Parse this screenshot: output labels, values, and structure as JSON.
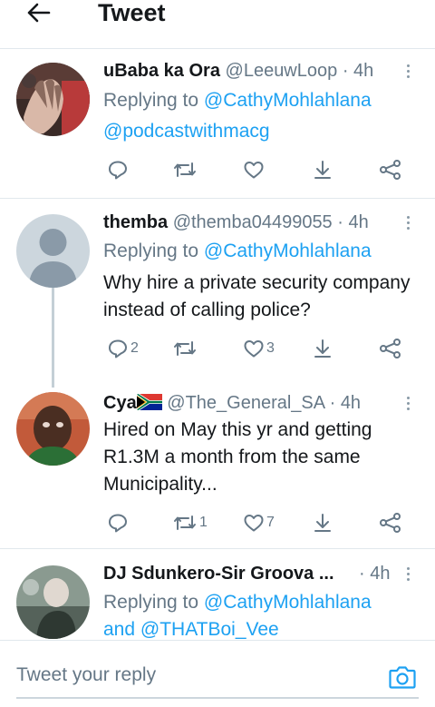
{
  "header": {
    "title": "Tweet"
  },
  "tweets": [
    {
      "name": "uBaba ka Ora",
      "handle": "@LeeuwLoop",
      "sep": "·",
      "time": "4h",
      "replying_label": "Replying to",
      "replying_to": [
        "@CathyMohlahlana",
        "@podcastwithmacg"
      ],
      "counts": {
        "reply": "",
        "retweet": "",
        "like": ""
      }
    },
    {
      "name": "themba",
      "handle": "@themba04499055",
      "sep": "·",
      "time": "4h",
      "replying_label": "Replying to",
      "replying_to": [
        "@CathyMohlahlana"
      ],
      "text_lines": [
        "Why hire a private security company",
        "instead of calling police?"
      ],
      "counts": {
        "reply": "2",
        "retweet": "",
        "like": "3"
      }
    },
    {
      "name": "Cya",
      "flag_icon": "south-africa-flag",
      "handle": "@The_General_SA",
      "sep": "·",
      "time": "4h",
      "text_lines": [
        "Hired on May this yr and getting",
        "R1.3M a month from the same",
        "Municipality..."
      ],
      "counts": {
        "reply": "",
        "retweet": "1",
        "like": "7"
      }
    },
    {
      "name": "DJ Sdunkero-Sir Groova ...",
      "sep": "·",
      "time": "4h",
      "replying_label": "Replying to",
      "replying_to": [
        "@CathyMohlahlana"
      ],
      "conjunction": "and",
      "replying_to_more": "@THATBoi_Vee"
    }
  ],
  "reply_bar": {
    "placeholder": "Tweet your reply"
  },
  "colors": {
    "link": "#1da1f2",
    "secondary_text": "#657786",
    "primary_text": "#14171a",
    "divider": "#e1e8ed"
  },
  "icons": [
    "back-arrow",
    "more-vertical",
    "reply",
    "retweet",
    "like",
    "download",
    "share",
    "camera",
    "default-avatar"
  ]
}
